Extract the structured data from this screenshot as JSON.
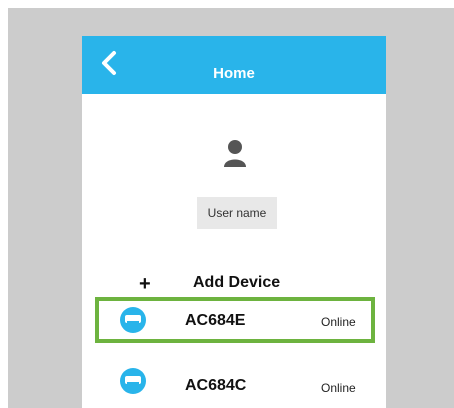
{
  "header": {
    "title": "Home",
    "back_icon": "chevron-left-icon",
    "background": "#29b4ea"
  },
  "profile": {
    "avatar_icon": "user-silhouette-icon",
    "username": "User name"
  },
  "add_device": {
    "icon": "plus-icon",
    "label": "Add Device"
  },
  "devices": [
    {
      "name": "AC684E",
      "status": "Online",
      "selected": true,
      "icon": "air-conditioner-icon"
    },
    {
      "name": "AC684C",
      "status": "Online",
      "selected": false,
      "icon": "air-conditioner-icon"
    }
  ],
  "colors": {
    "accent": "#29b4ea",
    "highlight": "#6db33f"
  }
}
